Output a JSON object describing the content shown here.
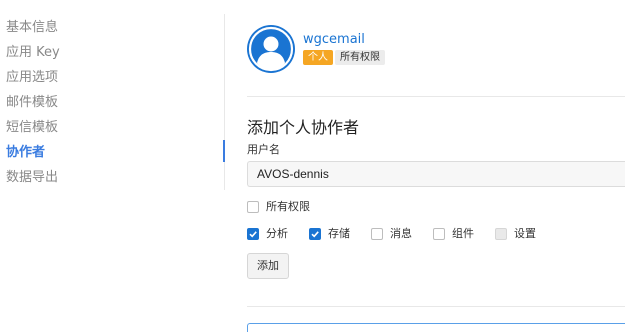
{
  "sidebar": {
    "items": [
      {
        "label": "基本信息"
      },
      {
        "label": "应用 Key"
      },
      {
        "label": "应用选项"
      },
      {
        "label": "邮件模板"
      },
      {
        "label": "短信模板"
      },
      {
        "label": "协作者",
        "active": true
      },
      {
        "label": "数据导出"
      }
    ]
  },
  "profile": {
    "username": "wgcemail",
    "badge_type": "个人",
    "badge_permission": "所有权限",
    "avatar_icon": "user-avatar-icon",
    "avatar_color": "#1a74d2"
  },
  "form": {
    "title": "添加个人协作者",
    "username_label": "用户名",
    "username_value": "AVOS-dennis",
    "all_permissions": {
      "label": "所有权限",
      "checked": false
    },
    "permissions": [
      {
        "label": "分析",
        "checked": true
      },
      {
        "label": "存储",
        "checked": true
      },
      {
        "label": "消息",
        "checked": false
      },
      {
        "label": "组件",
        "checked": false
      },
      {
        "label": "设置",
        "checked": false,
        "disabled": true
      }
    ],
    "add_button": "添加"
  },
  "colors": {
    "accent": "#1a74d2",
    "active_nav": "#3a7ce0",
    "badge_orange": "#f5a623"
  }
}
